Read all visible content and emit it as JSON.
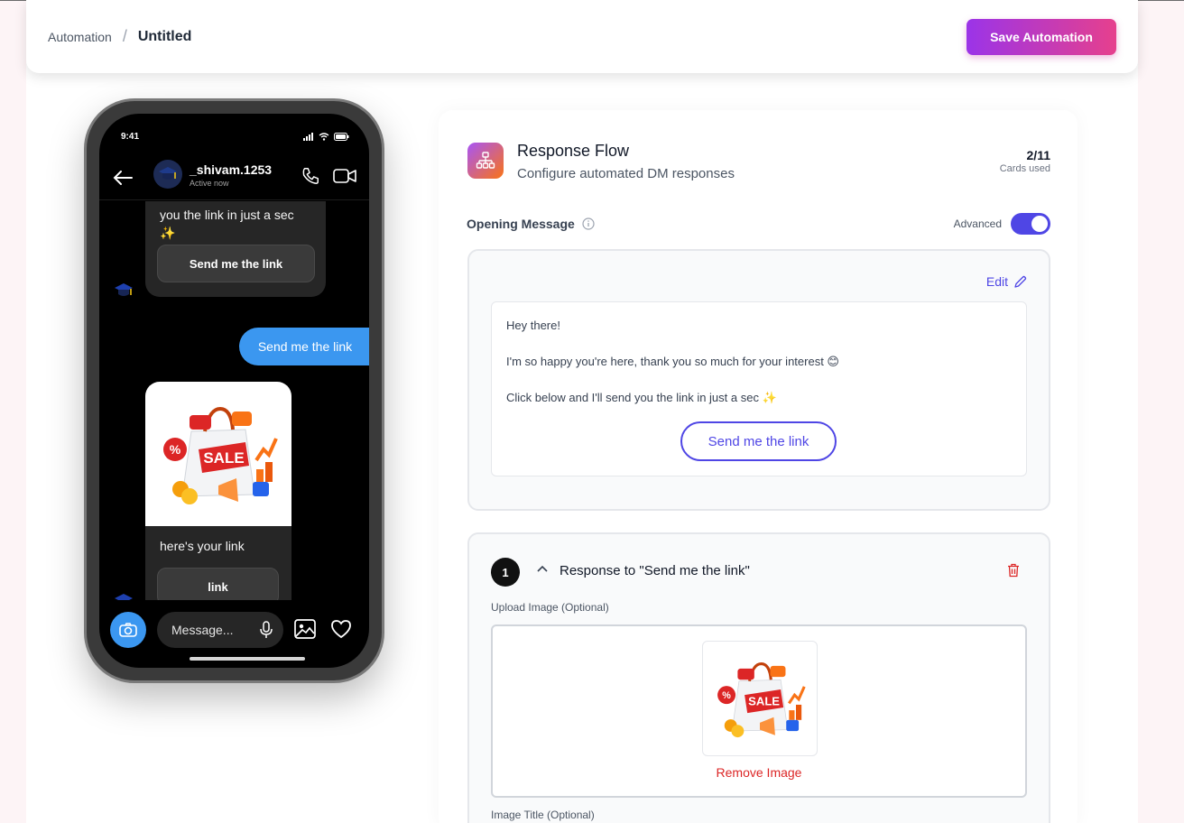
{
  "header": {
    "breadcrumb_root": "Automation",
    "breadcrumb_sep": "/",
    "breadcrumb_current": "Untitled",
    "save_label": "Save Automation"
  },
  "phone": {
    "time": "9:41",
    "username": "_shivam.1253",
    "presence": "Active now",
    "msg_partial_line1": "you the link in just a sec",
    "msg_partial_line2": "✨",
    "msg_button": "Send me the link",
    "sent_reply": "Send me the link",
    "card_caption": "here's your link",
    "card_button": "link",
    "composer_placeholder": "Message..."
  },
  "panel": {
    "flow_title": "Response Flow",
    "flow_subtitle": "Configure automated DM responses",
    "cards_count": "2/11",
    "cards_label": "Cards used",
    "opening_label": "Opening Message",
    "advanced_label": "Advanced",
    "advanced_on": true,
    "edit_label": "Edit",
    "message_lines": [
      "Hey there!",
      "I'm so happy you're here, thank you so much for your interest 😊",
      "Click below and I'll send you the link in just a sec ✨"
    ],
    "message_button": "Send me the link",
    "response_number": "1",
    "response_title": "Response to \"Send me the link\"",
    "upload_label": "Upload Image (Optional)",
    "remove_image": "Remove Image",
    "image_title_label": "Image Title (Optional)"
  },
  "colors": {
    "accent": "#4f46e5",
    "save_gradient_start": "#9b34e8",
    "save_gradient_end": "#e6408d",
    "danger": "#dc2626",
    "ig_blue": "#3b97f0"
  }
}
